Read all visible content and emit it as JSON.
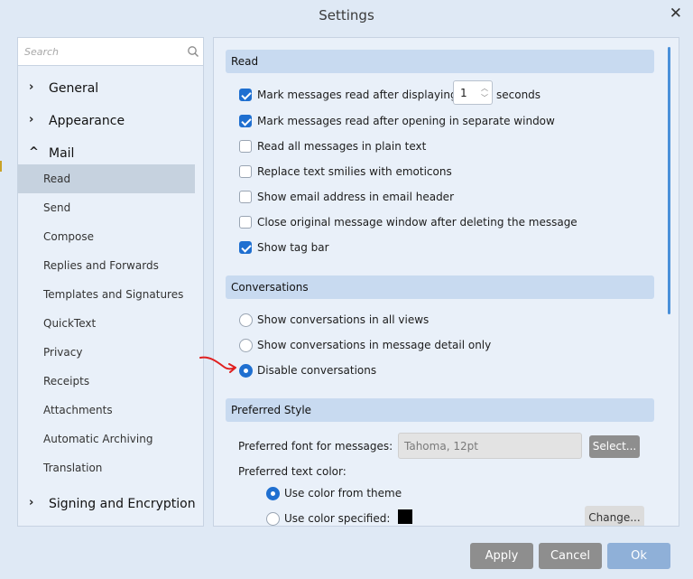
{
  "window": {
    "title": "Settings",
    "close_glyph": "✕"
  },
  "sidebar": {
    "search_placeholder": "Search",
    "categories": [
      {
        "chevron": "›",
        "label": "General"
      },
      {
        "chevron": "›",
        "label": "Appearance"
      },
      {
        "chevron": "^",
        "label": "Mail"
      },
      {
        "chevron": "›",
        "label": "Signing and Encryption"
      }
    ],
    "mail_items": [
      "Read",
      "Send",
      "Compose",
      "Replies and Forwards",
      "Templates and Signatures",
      "QuickText",
      "Privacy",
      "Receipts",
      "Attachments",
      "Automatic Archiving",
      "Translation"
    ],
    "selected_item": "Read"
  },
  "read": {
    "header": "Read",
    "mark_read_label": "Mark messages read after displaying for",
    "mark_read_value": "1",
    "mark_read_suffix": "seconds",
    "options": [
      {
        "label": "Mark messages read after displaying for",
        "checked": true
      },
      {
        "label": "Mark messages read after opening in separate window",
        "checked": true
      },
      {
        "label": "Read all messages in plain text",
        "checked": false
      },
      {
        "label": "Replace text smilies with emoticons",
        "checked": false
      },
      {
        "label": "Show email address in email header",
        "checked": false
      },
      {
        "label": "Close original message window after deleting the message",
        "checked": false
      },
      {
        "label": "Show tag bar",
        "checked": true
      }
    ]
  },
  "conversations": {
    "header": "Conversations",
    "options": [
      {
        "label": "Show conversations in all views",
        "selected": false
      },
      {
        "label": "Show conversations in message detail only",
        "selected": false
      },
      {
        "label": "Disable conversations",
        "selected": true
      }
    ]
  },
  "preferred_style": {
    "header": "Preferred Style",
    "font_label": "Preferred font for messages:",
    "font_value": "Tahoma, 12pt",
    "select_button": "Select...",
    "text_color_label": "Preferred text color:",
    "use_theme_label": "Use color from theme",
    "use_specified_label": "Use color specified:",
    "specified_color": "#000000",
    "change_button": "Change..."
  },
  "footer": {
    "apply": "Apply",
    "cancel": "Cancel",
    "ok": "Ok"
  },
  "colors": {
    "accent": "#1f6fd0",
    "ok_button": "#8fb0d8",
    "annotation": "#e02020"
  }
}
